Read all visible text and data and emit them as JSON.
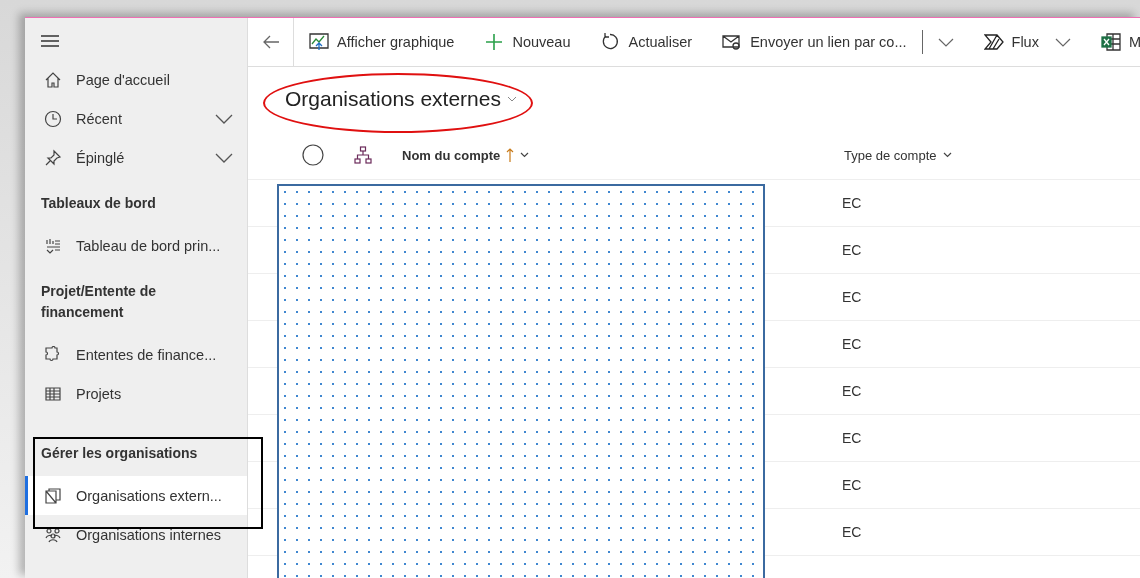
{
  "sidebar": {
    "items": [
      {
        "kind": "link",
        "label": "Page d'accueil",
        "selected": false
      },
      {
        "kind": "expandable",
        "label": "Récent",
        "selected": false
      },
      {
        "kind": "expandable",
        "label": "Épinglé",
        "selected": false
      },
      {
        "kind": "header",
        "label": "Tableaux de bord"
      },
      {
        "kind": "link",
        "label": "Tableau de bord prin...",
        "selected": false
      },
      {
        "kind": "header",
        "label": "Projet/Entente de financement"
      },
      {
        "kind": "link",
        "label": "Ententes de finance...",
        "selected": false
      },
      {
        "kind": "link",
        "label": "Projets",
        "selected": false
      },
      {
        "kind": "header",
        "label": "Gérer les organisations"
      },
      {
        "kind": "link",
        "label": "Organisations extern...",
        "selected": true
      },
      {
        "kind": "link",
        "label": "Organisations internes",
        "selected": false
      }
    ]
  },
  "toolbar": {
    "items": [
      {
        "kind": "button",
        "label": "Afficher graphique"
      },
      {
        "kind": "button",
        "label": "Nouveau"
      },
      {
        "kind": "button",
        "label": "Actualiser"
      },
      {
        "kind": "button",
        "label": "Envoyer un lien par co..."
      },
      {
        "kind": "dropdown"
      },
      {
        "kind": "menu-button",
        "label": "Flux"
      },
      {
        "kind": "button",
        "label": "M"
      }
    ]
  },
  "view": {
    "title": "Organisations externes"
  },
  "table": {
    "all_selected": false,
    "columns": [
      {
        "label": "Nom du compte",
        "sorted_ascending": true
      },
      {
        "label": "Type de compte",
        "sorted_ascending": false
      }
    ],
    "name_column_redacted": true,
    "rows": [
      {
        "type": "EC"
      },
      {
        "type": "EC"
      },
      {
        "type": "EC"
      },
      {
        "type": "EC"
      },
      {
        "type": "EC"
      },
      {
        "type": "EC"
      },
      {
        "type": "EC"
      },
      {
        "type": "EC"
      }
    ]
  },
  "annotations": [
    {
      "kind": "ellipse"
    },
    {
      "kind": "rectangle"
    }
  ]
}
